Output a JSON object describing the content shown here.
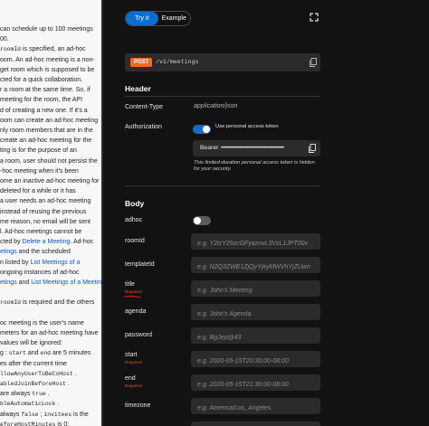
{
  "doc": {
    "lines": [
      [
        {
          "t": "can schedule up to 100 meetings"
        }
      ],
      [
        {
          "t": "00."
        }
      ],
      [
        {
          "t": "roomId",
          "c": "code"
        },
        {
          "t": " is specified, an ad-hoc"
        }
      ],
      [
        {
          "t": "oom. An ad-hoc meeting is a non-"
        }
      ],
      [
        {
          "t": "get room which is supposed to be"
        }
      ],
      [
        {
          "t": "cted for a quick collaboration."
        }
      ],
      [
        {
          "t": "r a room at the same time. So, if"
        }
      ],
      [
        {
          "t": "meeting for the room, the API"
        }
      ],
      [
        {
          "t": "d of creating a new one. If it's a"
        }
      ],
      [
        {
          "t": "oom can create an ad-hoc meeting"
        }
      ],
      [
        {
          "t": "nly room members that are in the"
        }
      ],
      [
        {
          "t": " create an ad-hoc meeting for the"
        }
      ],
      [
        {
          "t": "ting is for the purpose of an"
        }
      ],
      [
        {
          "t": "a room, user should not persist the"
        }
      ],
      [
        {
          "t": "-hoc meeting when it's been"
        }
      ],
      [
        {
          "t": "ome an inactive ad-hoc meeting for"
        }
      ],
      [
        {
          "t": "deleted for a while or it has"
        }
      ],
      [
        {
          "t": " a user needs an ad-hoc meeting"
        }
      ],
      [
        {
          "t": "instead of reusing the previous"
        }
      ],
      [
        {
          "t": "me reason, no email will be sent"
        }
      ],
      [
        {
          "t": "l. Ad-hoc meetings cannot be"
        }
      ],
      [
        {
          "t": "cted by "
        },
        {
          "t": "Delete a Meeting",
          "c": "lnk"
        },
        {
          "t": ". Ad-hoc"
        }
      ],
      [
        {
          "t": "etings",
          "c": "lnk"
        },
        {
          "t": " and the scheduled"
        }
      ],
      [
        {
          "t": "n listed by "
        },
        {
          "t": "List Meetings of a",
          "c": "lnk"
        }
      ],
      [
        {
          "t": "ongoing instances of ad-hoc"
        }
      ],
      [
        {
          "t": "etings",
          "c": "lnk"
        },
        {
          "t": " and "
        },
        {
          "t": "List Meetings of a Meeting",
          "c": "lnk"
        }
      ],
      [
        {
          "t": ""
        }
      ],
      [
        {
          "t": "roomId",
          "c": "code"
        },
        {
          "t": " is required and the others"
        }
      ],
      [
        {
          "t": ""
        }
      ],
      [
        {
          "t": "oc meeting is the user's name"
        }
      ],
      [
        {
          "t": "meters for an ad-hoc meeting have"
        }
      ],
      [
        {
          "t": " values will be ignored:"
        }
      ],
      [
        {
          "t": "g : "
        },
        {
          "t": "start",
          "c": "code"
        },
        {
          "t": " and "
        },
        {
          "t": "end",
          "c": "code"
        },
        {
          "t": " are 5 minutes"
        }
      ],
      [
        {
          "t": "es after the current time"
        }
      ],
      [
        {
          "t": "llowAnyUserToBeCoHost",
          "c": "code"
        },
        {
          "t": " ."
        }
      ],
      [
        {
          "t": "abledJoinBeforeHost",
          "c": "code"
        },
        {
          "t": " ."
        }
      ],
      [
        {
          "t": "are always "
        },
        {
          "t": "true",
          "c": "code"
        },
        {
          "t": " ."
        }
      ],
      [
        {
          "t": "bleAutomaticLock",
          "c": "code"
        },
        {
          "t": " ."
        }
      ],
      [
        {
          "t": "always "
        },
        {
          "t": "false",
          "c": "code"
        },
        {
          "t": " ; "
        },
        {
          "t": "invitees",
          "c": "code"
        },
        {
          "t": " is the"
        }
      ],
      [
        {
          "t": "eforeHostMinutes",
          "c": "code"
        },
        {
          "t": " is 0;"
        }
      ],
      [
        {
          "t": "ckedMeetingJoinSecurity",
          "c": "code"
        },
        {
          "t": " is"
        }
      ]
    ]
  },
  "panel": {
    "tabs": [
      "Try it",
      "Example"
    ],
    "endpoint": {
      "method": "POST",
      "path": "/v1/meetings"
    },
    "header_section": "Header",
    "content_type": {
      "label": "Content-Type",
      "value": "application/json"
    },
    "authorization": {
      "label": "Authorization",
      "toggle_on": true,
      "toggle_label": "Use personal access token",
      "bearer_label": "Bearer",
      "token_mask": "•••••••••••••••••••••••••••••••••••••",
      "note": "This limited-duration personal access token is hidden for your security."
    },
    "body_section": "Body",
    "required_text": "Required",
    "adhoc": {
      "label": "adhoc",
      "toggle_on": false
    },
    "fields": [
      {
        "name": "roomId",
        "placeholder": "e.g. Y2lzY29zcGFyazovL3VzL1JPT00v",
        "required": false
      },
      {
        "name": "templateId",
        "placeholder": "e.g. N2Q3ZWE1ZjQyYjkyMWVhYjZUwn",
        "required": false
      },
      {
        "name": "title",
        "placeholder": "e.g. John's Meeting",
        "required": true
      },
      {
        "name": "agenda",
        "placeholder": "e.g. John's Agenda",
        "required": false
      },
      {
        "name": "password",
        "placeholder": "e.g. BgJep@43",
        "required": false
      },
      {
        "name": "start",
        "placeholder": "e.g. 2020-05-15T20:30:00-08:00",
        "required": true
      },
      {
        "name": "end",
        "placeholder": "e.g. 2020-05-15T21:30:00-08:00",
        "required": true
      },
      {
        "name": "timezone",
        "placeholder": "e.g. America/Los_Angeles",
        "required": false
      },
      {
        "name": "recurrence",
        "placeholder": "",
        "required": false
      }
    ]
  },
  "colors": {
    "accent": "#0a6fd1",
    "post_badge": "#f26b21",
    "required": "#e0502a",
    "link": "#0a56b8"
  },
  "icons": [
    "expand-icon",
    "copy-icon"
  ]
}
